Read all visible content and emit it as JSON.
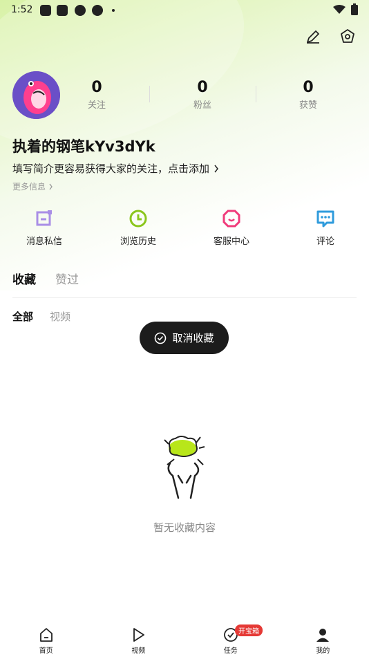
{
  "status_bar": {
    "time": "1:52"
  },
  "profile": {
    "stats": [
      {
        "value": "0",
        "label": "关注"
      },
      {
        "value": "0",
        "label": "粉丝"
      },
      {
        "value": "0",
        "label": "获赞"
      }
    ],
    "name": "执着的钢笔kYv3dYk",
    "bio": "填写简介更容易获得大家的关注，点击添加",
    "more_info": "更多信息"
  },
  "quick_actions": [
    {
      "label": "消息私信",
      "icon": "message-icon",
      "color": "#a98ee6"
    },
    {
      "label": "浏览历史",
      "icon": "history-clock-icon",
      "color": "#8bc61d"
    },
    {
      "label": "客服中心",
      "icon": "customer-service-icon",
      "color": "#f03a7a"
    },
    {
      "label": "评论",
      "icon": "comment-icon",
      "color": "#2f9bdc"
    }
  ],
  "tabs": [
    "收藏",
    "赞过"
  ],
  "subtabs": [
    "全部",
    "视频"
  ],
  "toast": {
    "text": "取消收藏"
  },
  "empty": {
    "text": "暂无收藏内容"
  },
  "bottom_nav": [
    {
      "label": "首页",
      "icon": "home-icon"
    },
    {
      "label": "视频",
      "icon": "play-icon"
    },
    {
      "label": "任务",
      "icon": "check-circle-icon",
      "badge": "开宝箱"
    },
    {
      "label": "我的",
      "icon": "user-icon"
    }
  ],
  "colors": {
    "accent_green": "#d8f2a6",
    "toast_bg": "#1c1c1c",
    "badge_red": "#e53935"
  }
}
